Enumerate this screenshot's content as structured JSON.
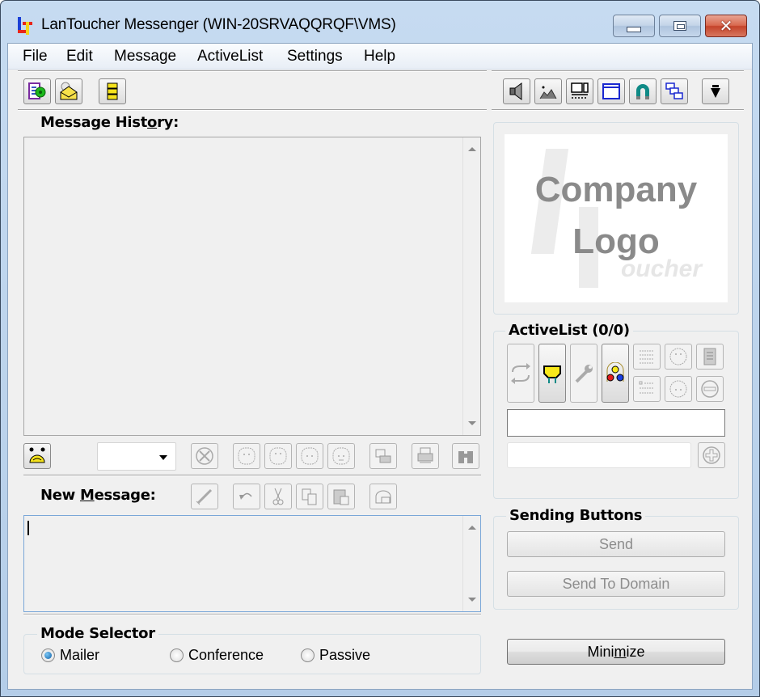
{
  "window": {
    "title": "LanToucher Messenger (WIN-20SRVAQQRQF\\VMS)",
    "controls": {
      "minimize": "minimize",
      "maximize": "maximize",
      "close": "close"
    }
  },
  "menu": [
    "File",
    "Edit",
    "Message",
    "ActiveList",
    "Settings",
    "Help"
  ],
  "toolbar_left": [
    {
      "icon": "settings-gear-list-icon"
    },
    {
      "icon": "open-mail-clock-icon"
    },
    {
      "icon": "yellow-list-icon"
    }
  ],
  "toolbar_right": [
    {
      "icon": "speaker-icon"
    },
    {
      "icon": "picture-icon"
    },
    {
      "icon": "layout-icon"
    },
    {
      "icon": "window-icon"
    },
    {
      "icon": "magnet-icon"
    },
    {
      "icon": "cascade-windows-icon"
    },
    {
      "icon": "dropdown-arrow-icon"
    }
  ],
  "message_history": {
    "label_pre": "Message Hist",
    "label_accel": "o",
    "label_post": "ry:",
    "content": ""
  },
  "history_toolbar": {
    "font_combo_value": "",
    "buttons": [
      "smiley-people-icon",
      "clear-icon",
      "smiley-1-icon",
      "smiley-2-icon",
      "smiley-3-icon",
      "smiley-4-icon",
      "save-icon",
      "print-icon",
      "find-binoculars-icon"
    ]
  },
  "new_message": {
    "label_pre": "New ",
    "label_accel": "M",
    "label_post": "essage:",
    "value": "",
    "buttons": [
      "spell-check-icon",
      "undo-icon",
      "cut-icon",
      "copy-icon",
      "paste-icon",
      "insert-template-icon"
    ]
  },
  "logo": {
    "line1": "Company",
    "line2": "Logo",
    "watermark": "oucher"
  },
  "activelist": {
    "title": "ActiveList (0/0)",
    "search_value": "",
    "add_value": "",
    "buttons": [
      "refresh-icon",
      "network-device-icon",
      "wrench-icon",
      "group-icon",
      "list-checked-icon",
      "smiley-up-icon",
      "document-icon",
      "list-unchecked-icon",
      "smiley-down-icon",
      "remove-icon"
    ],
    "add_button": "add-icon"
  },
  "sending": {
    "title": "Sending Buttons",
    "send": "Send",
    "send_to_domain": "Send To Domain"
  },
  "mode_selector": {
    "title": "Mode Selector",
    "options": [
      {
        "label": "Mailer",
        "checked": true
      },
      {
        "label": "Conference",
        "checked": false
      },
      {
        "label": "Passive",
        "checked": false
      }
    ]
  },
  "minimize_button": {
    "pre": "Mini",
    "accel": "m",
    "post": "ize"
  },
  "colors": {
    "accent_blue": "#1e5fa8",
    "close_red": "#c4432a",
    "frame": "#b4cde8"
  }
}
